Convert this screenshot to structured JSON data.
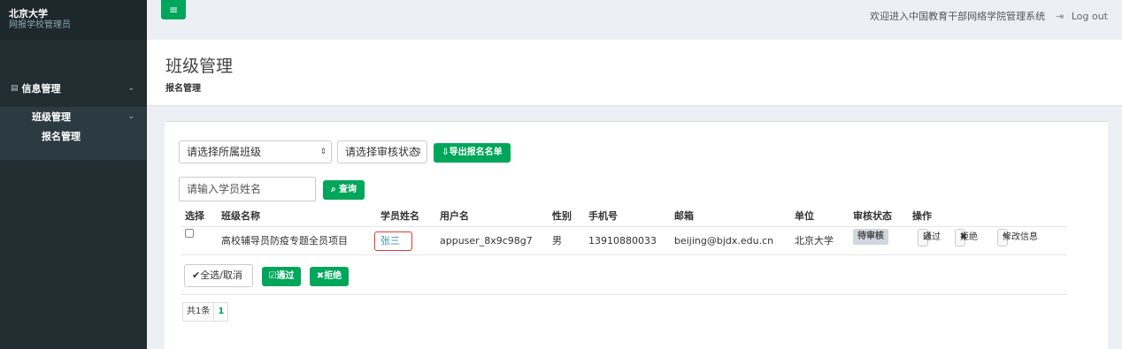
{
  "brand": {
    "title": "北京大学",
    "subtitle": "网报学校管理员"
  },
  "sidebar": {
    "items": [
      {
        "label": "信息管理",
        "icon": "card-icon"
      },
      {
        "label": "班级管理"
      },
      {
        "label": "报名管理"
      }
    ]
  },
  "header": {
    "toggle_label": "≡",
    "welcome": "欢迎进入中国教育干部网络学院管理系统",
    "logout_label": "Log out"
  },
  "content": {
    "title": "班级管理",
    "subtitle": "报名管理"
  },
  "filters": {
    "class_select": "请选择所属班级",
    "status_select": "请选择审核状态",
    "export_label": "⇩导出报名名单",
    "name_placeholder": "请输入学员姓名",
    "search_label": "查询"
  },
  "table": {
    "headers": [
      "选择",
      "班级名称",
      "学员姓名",
      "用户名",
      "性别",
      "手机号",
      "邮箱",
      "单位",
      "审核状态",
      "操作"
    ],
    "rows": [
      {
        "class_name": "高校辅导员防疫专题全员项目",
        "student_name": "张三",
        "username": "appuser_8x9c98g7",
        "gender": "男",
        "phone": "13910880033",
        "email": "beijing@bjdx.edu.cn",
        "unit": "北京大学",
        "status": "待审核",
        "actions": {
          "approve": "通过",
          "reject": "拒绝",
          "edit": "修改信息"
        }
      }
    ]
  },
  "bulk": {
    "select_all": "全选/取消",
    "approve": "通过",
    "reject": "拒绝"
  },
  "pager": {
    "total": "共1条",
    "page": "1"
  },
  "colors": {
    "accent": "#00a65a",
    "sidebar": "#222d32",
    "link": "#3c8dbc",
    "highlight": "#e53935"
  }
}
